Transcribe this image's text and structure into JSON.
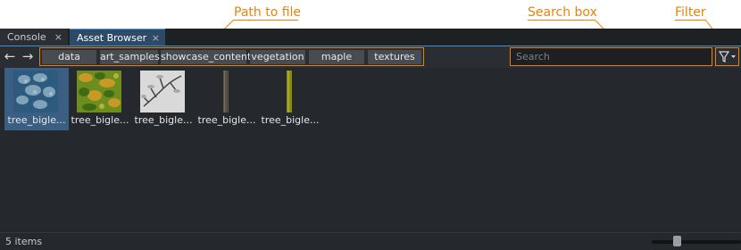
{
  "annotations": {
    "path": "Path to file",
    "search": "Search box",
    "filter": "Filter"
  },
  "tabs": [
    {
      "label": "Console",
      "close": "×",
      "active": false
    },
    {
      "label": "Asset Browser",
      "close": "×",
      "active": true
    }
  ],
  "toolbar": {
    "back": "←",
    "forward": "→",
    "breadcrumbs": [
      "data",
      "art_samples",
      "showcase_content",
      "vegetation",
      "maple",
      "textures"
    ],
    "search_placeholder": "Search",
    "search_value": ""
  },
  "assets": [
    {
      "name": "tree_bigle...",
      "selected": true,
      "icon": "leaf-cluster-texture-icon"
    },
    {
      "name": "tree_bigle...",
      "selected": false,
      "icon": "foliage-color-texture-icon"
    },
    {
      "name": "tree_bigle...",
      "selected": false,
      "icon": "branch-grayscale-texture-icon"
    },
    {
      "name": "tree_bigle...",
      "selected": false,
      "icon": "bark-texture-icon"
    },
    {
      "name": "tree_bigle...",
      "selected": false,
      "icon": "stem-texture-icon"
    }
  ],
  "status": {
    "item_count": "5 items",
    "thumbnail_size": 0.3
  },
  "colors": {
    "accent_callout": "#e8820c",
    "selection": "#3b5f82",
    "background": "#25282c"
  }
}
